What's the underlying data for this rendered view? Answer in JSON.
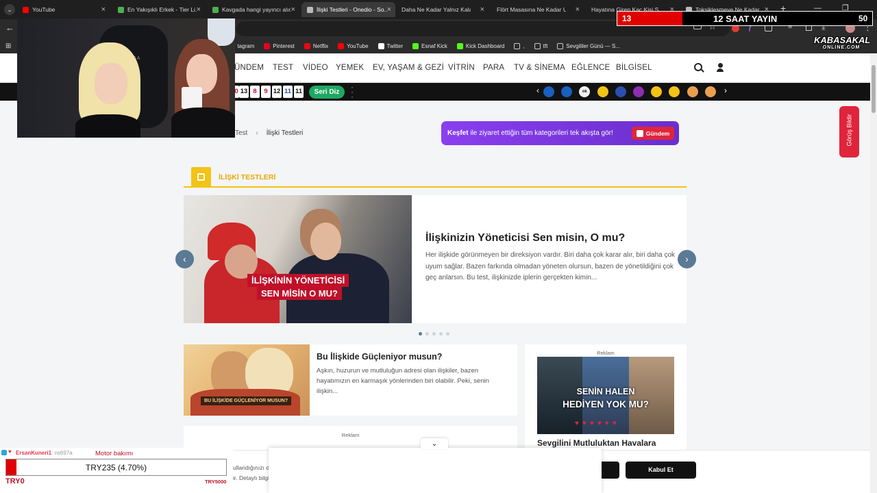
{
  "browser": {
    "tabs": [
      {
        "title": "YouTube",
        "favicon_color": "#ff0000"
      },
      {
        "title": "En Yakışıklı Erkek - Tier Li...",
        "favicon_color": "#4caf50"
      },
      {
        "title": "Kavgada hangi yayıncı alır...",
        "favicon_color": "#4caf50"
      },
      {
        "title": "İlişki Testleri - Onedio - So...",
        "favicon_color": "#bbbbbb"
      },
      {
        "title": "Daha Ne Kadar Yalnız Kalac...",
        "favicon_color": ""
      },
      {
        "title": "Flört Masasına Ne Kadar U...",
        "favicon_color": ""
      },
      {
        "title": "Hayatına Giren Kaç Kişi S...",
        "favicon_color": ""
      },
      {
        "title": "Toksikleşmeye Ne Kadar...",
        "favicon_color": "#bbbbbb"
      }
    ],
    "new_tab": "+",
    "bookmarks": [
      {
        "label": "tagram",
        "color": "#e1306c"
      },
      {
        "label": "Pinterest",
        "color": "#e60023"
      },
      {
        "label": "Netflix",
        "color": "#e50914"
      },
      {
        "label": "YouTube",
        "color": "#ff0000"
      },
      {
        "label": "Twitter",
        "color": "#ffffff"
      },
      {
        "label": "Esnaf Kick",
        "color": "#53fc18"
      },
      {
        "label": "Kick Dashboard",
        "color": "#53fc18"
      },
      {
        "label": ",",
        "color": "#cccccc"
      },
      {
        "label": "tft",
        "color": "#cccccc"
      },
      {
        "label": "Sevgililer Günü — S...",
        "color": "#cccccc"
      }
    ]
  },
  "overlay": {
    "counter_left": "13",
    "counter_label": "12 SAAT YAYIN",
    "counter_right": "50",
    "logo_line1": "KABASAKAL",
    "logo_line2": "ONLINE.COM",
    "donation_user": "ErsanKuneri1",
    "donation_partial": ": ns697a",
    "donation_note": "Motor bakımı",
    "donation_amount": "TRY235 (4.70%)",
    "donation_min": "TRY0",
    "donation_max": "TRY5000",
    "donation_progress": 0.047
  },
  "nav": {
    "items": [
      "ÜNDEM",
      "TEST",
      "VİDEO",
      "YEMEK",
      "EV, YAŞAM & GEZİ",
      "VİTRİN",
      "PARA",
      "TV & SİNEMA",
      "EĞLENCE",
      "BİLGİSEL"
    ]
  },
  "darkbar": {
    "tiles": [
      "0",
      "13",
      "8",
      "9",
      "12",
      "11",
      "11"
    ],
    "seri_diz": "Seri Diz",
    "stories": [
      "",
      "",
      "ok",
      "",
      "",
      "",
      "",
      "",
      "",
      ""
    ]
  },
  "breadcrumb": {
    "parent": "Test",
    "current": "İlişki Testleri"
  },
  "kesfet": {
    "bold": "Keşfet",
    "text": " ile ziyaret ettiğin tüm kategorileri tek akışta gör!",
    "button": "Gündem"
  },
  "feedback": "Görüş Bildir",
  "section_title": "İLİŞKİ TESTLERİ",
  "slider": {
    "image_text": [
      "İLİŞKİNİN YÖNETİCİSİ",
      "SEN MİSİN O MU?"
    ],
    "title": "İlişkinizin Yöneticisi Sen misin, O mu?",
    "description": "Her ilişkide görünmeyen bir direksiyon vardır. Biri daha çok karar alır, biri daha çok uyum sağlar. Bazen farkında olmadan yöneten olursun, bazen de yönetildiğini çok geç anlarsın. Bu test, ilişkinizde iplerin gerçekten kimin...",
    "dots": 5,
    "active_dot": 0
  },
  "card2": {
    "image_text": "BU İLİŞKİDE GÜÇLENİYOR MUSUN?",
    "title": "Bu İlişkide Güçleniyor musun?",
    "description": "Aşkın, huzurun ve mutluluğun adresi olan ilişkiler, bazen hayatımızın en karmaşık yönlerinden biri olabilir. Peki, senin ilişkin..."
  },
  "ad": {
    "label": "Reklam",
    "image_text": [
      "SENİN HALEN",
      "HEDİYEN YOK MU?"
    ],
    "title": "Sevgilini Mutluluktan Havalara"
  },
  "ad2": {
    "label": "Reklam"
  },
  "cookie": {
    "text1": "ullandığınızı dah",
    "text2": "ir. Detaylı bilgi iç",
    "accept": "Kabul Et"
  }
}
